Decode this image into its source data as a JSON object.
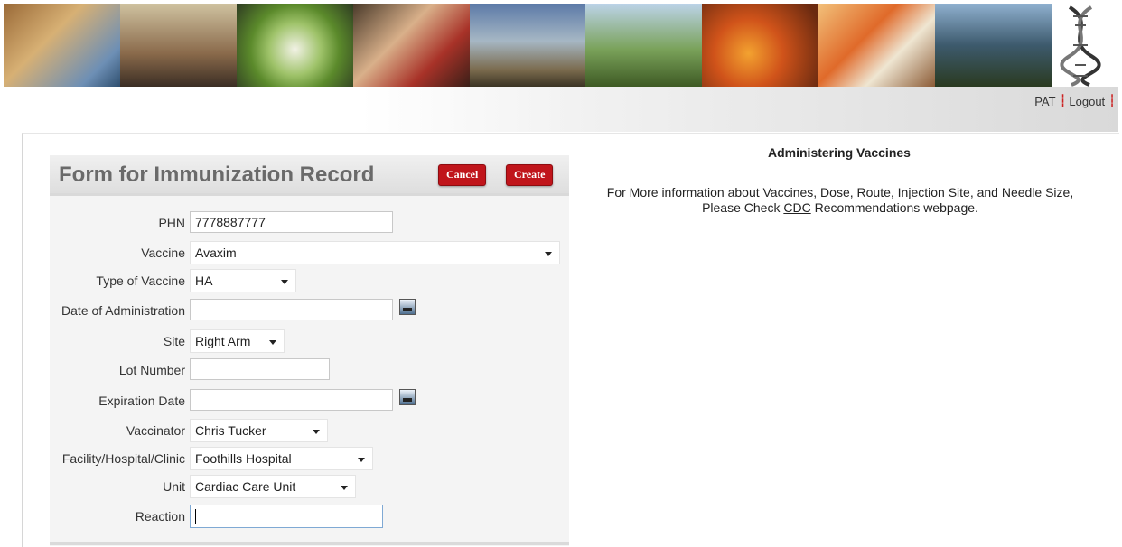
{
  "header": {
    "user": "PAT",
    "logout": "Logout"
  },
  "banner_icons": [
    "banner-photo-collage",
    "dna-helix-icon"
  ],
  "form": {
    "title": "Form for Immunization Record",
    "cancel_label": "Cancel",
    "create_label": "Create",
    "fields": {
      "phn": {
        "label": "PHN",
        "value": "7778887777"
      },
      "vaccine": {
        "label": "Vaccine",
        "value": "Avaxim"
      },
      "type": {
        "label": "Type of Vaccine",
        "value": "HA"
      },
      "date_admin": {
        "label": "Date of Administration",
        "value": ""
      },
      "site": {
        "label": "Site",
        "value": "Right Arm"
      },
      "lot": {
        "label": "Lot Number",
        "value": ""
      },
      "expiration": {
        "label": "Expiration Date",
        "value": ""
      },
      "vaccinator": {
        "label": "Vaccinator",
        "value": "Chris Tucker"
      },
      "facility": {
        "label": "Facility/Hospital/Clinic",
        "value": "Foothills Hospital"
      },
      "unit": {
        "label": "Unit",
        "value": "Cardiac Care Unit"
      },
      "reaction": {
        "label": "Reaction",
        "value": ""
      }
    }
  },
  "info": {
    "title": "Administering Vaccines",
    "line1": "For More information about Vaccines, Dose, Route, Injection Site, and Needle Size,",
    "line2_prefix": "Please Check",
    "line2_link": "CDC",
    "line2_suffix": "Recommendations webpage."
  },
  "colors": {
    "accent_button": "#c0151b",
    "panel_bg": "#f4f4f4",
    "title_gray": "#6a6a6a"
  }
}
